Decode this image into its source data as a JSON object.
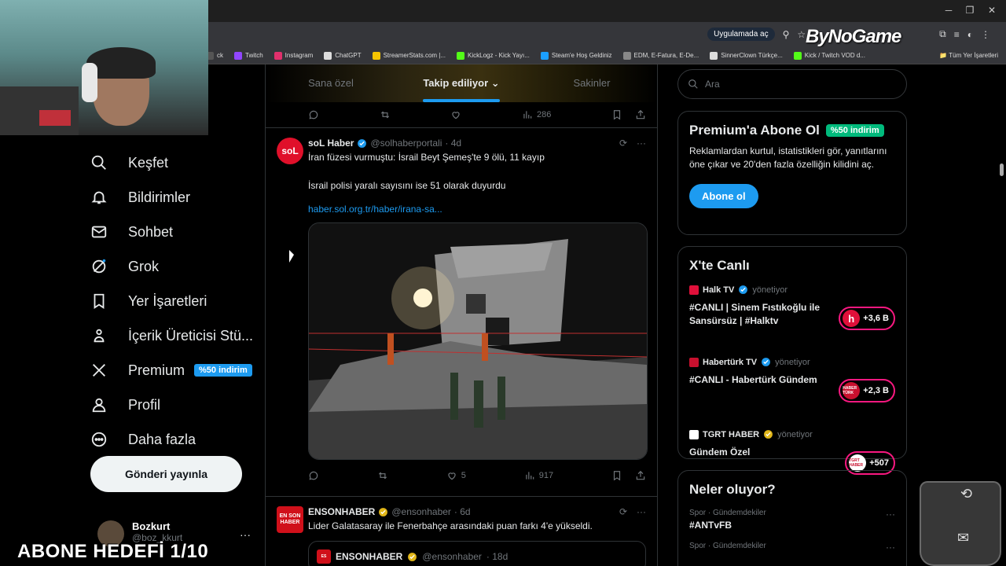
{
  "browser": {
    "open_in_app": "Uygulamada aç",
    "bookmarks": [
      {
        "label": "ck",
        "color": "#555"
      },
      {
        "label": "Twitch",
        "color": "#9146ff"
      },
      {
        "label": "Instagram",
        "color": "#e1306c"
      },
      {
        "label": "ChatGPT",
        "color": "#ddd"
      },
      {
        "label": "StreamerStats.com |...",
        "color": "#f5c400"
      },
      {
        "label": "KickLogz - Kick Yayı...",
        "color": "#53fc18"
      },
      {
        "label": "Steam'e Hoş Geldiniz",
        "color": "#1b9fff"
      },
      {
        "label": "EDM, E-Fatura, E-De...",
        "color": "#888"
      },
      {
        "label": "SinnerClown Türkçe...",
        "color": "#ddd"
      },
      {
        "label": "Kick / Twitch VOD d...",
        "color": "#53fc18"
      }
    ],
    "all_bookmarks": "Tüm Yer İşaretleri",
    "watermark": "ByNoGame"
  },
  "nav": {
    "items": [
      {
        "label": "Keşfet",
        "icon": "search-icon"
      },
      {
        "label": "Bildirimler",
        "icon": "bell-icon"
      },
      {
        "label": "Sohbet",
        "icon": "mail-icon"
      },
      {
        "label": "Grok",
        "icon": "grok-icon"
      },
      {
        "label": "Yer İşaretleri",
        "icon": "bookmark-icon"
      },
      {
        "label": "İçerik Üreticisi Stü...",
        "icon": "creator-icon"
      },
      {
        "label": "Premium",
        "icon": "x-logo-icon"
      },
      {
        "label": "Profil",
        "icon": "person-icon"
      },
      {
        "label": "Daha fazla",
        "icon": "more-circle-icon"
      }
    ],
    "premium_badge": "%50 indirim",
    "post_button": "Gönderi yayınla",
    "profile": {
      "name": "Bozkurt",
      "handle": "@boz_kkurt"
    }
  },
  "overlay": {
    "goal": "ABONE HEDEFİ 1/10"
  },
  "timeline": {
    "tabs": [
      "Sana özel",
      "Takip ediliyor",
      "Sakinler"
    ],
    "prev_actions": {
      "views": "286"
    },
    "tweets": [
      {
        "name": "soL Haber",
        "handle": "@solhaberportali",
        "time": "· 4d",
        "avatar_text": "soL",
        "avatar_color": "#e0102a",
        "text1": "İran füzesi vurmuştu: İsrail Beyt Şemeş'te 9 ölü, 11 kayıp",
        "text2": "İsrail polisi yaralı sayısını ise 51 olarak duyurdu",
        "link": "haber.sol.org.tr/haber/irana-sa...",
        "likes": "5",
        "views": "917"
      },
      {
        "name": "ENSONHABER",
        "handle": "@ensonhaber",
        "time": "· 6d",
        "avatar_text": "EN SON HABER",
        "avatar_color": "#d0101a",
        "text1": "Lider Galatasaray ile Fenerbahçe arasındaki puan farkı 4'e yükseldi.",
        "quote": {
          "name": "ENSONHABER",
          "handle": "@ensonhaber",
          "time": "· 18d"
        }
      }
    ]
  },
  "sidebar": {
    "search_placeholder": "Ara",
    "premium": {
      "title": "Premium'a Abone Ol",
      "discount": "%50 indirim",
      "text": "Reklamlardan kurtul, istatistikleri gör, yanıtlarını öne çıkar ve 20'den fazla özelliğin kilidini aç.",
      "button": "Abone ol"
    },
    "live": {
      "title": "X'te Canlı",
      "items": [
        {
          "host": "Halk TV",
          "role": "yönetiyor",
          "title": "#CANLI | Sinem Fıstıkoğlu ile Sansürsüz | #Halktv",
          "count": "+3,6 B",
          "color": "#e0103a",
          "logo": "h"
        },
        {
          "host": "Habertürk TV",
          "role": "yönetiyor",
          "title": "#CANLI - Habertürk Gündem",
          "count": "+2,3 B",
          "color": "#c8102e",
          "logo": "HABER TÜRK"
        },
        {
          "host": "TGRT HABER",
          "role": "yönetiyor",
          "title": "Gündem Özel",
          "count": "+507",
          "color": "#ffffff",
          "logo": "TGRT HABER"
        }
      ]
    },
    "trends": {
      "title": "Neler oluyor?",
      "items": [
        {
          "meta": "Spor · Gündemdekiler",
          "name": "#ANTvFB"
        },
        {
          "meta": "Spor · Gündemdekiler",
          "name": ""
        }
      ]
    }
  }
}
